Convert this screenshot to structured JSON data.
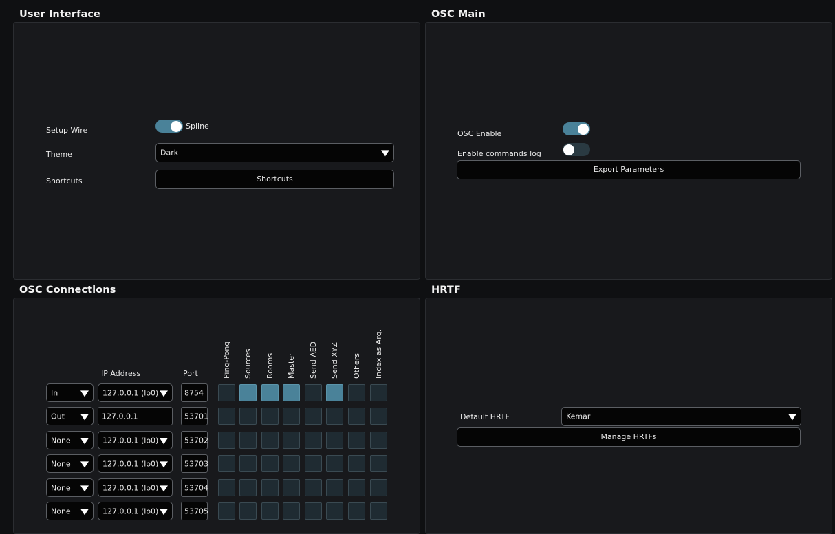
{
  "ui": {
    "title": "User Interface",
    "setup_wire_label": "Setup Wire",
    "setup_wire_toggle_label": "Spline",
    "setup_wire_on": true,
    "theme_label": "Theme",
    "theme_value": "Dark",
    "shortcuts_label": "Shortcuts",
    "shortcuts_button": "Shortcuts"
  },
  "osc_main": {
    "title": "OSC Main",
    "enable_label": "OSC Enable",
    "enable_on": true,
    "log_label": "Enable commands log",
    "log_on": false,
    "export_button": "Export Parameters"
  },
  "osc_conn": {
    "title": "OSC Connections",
    "ip_header": "IP Address",
    "port_header": "Port",
    "columns": [
      "Ping-Pong",
      "Sources",
      "Rooms",
      "Master",
      "Send AED",
      "Send XYZ",
      "Others",
      "Index as Arg."
    ],
    "rows": [
      {
        "direction": "In",
        "ip": "127.0.0.1 (lo0)",
        "ip_is_combo": true,
        "port": "8754",
        "checks": [
          false,
          true,
          true,
          true,
          false,
          true,
          false,
          false
        ]
      },
      {
        "direction": "Out",
        "ip": "127.0.0.1",
        "ip_is_combo": false,
        "port": "53701",
        "checks": [
          false,
          false,
          false,
          false,
          false,
          false,
          false,
          false
        ]
      },
      {
        "direction": "None",
        "ip": "127.0.0.1 (lo0)",
        "ip_is_combo": true,
        "port": "53702",
        "checks": [
          false,
          false,
          false,
          false,
          false,
          false,
          false,
          false
        ]
      },
      {
        "direction": "None",
        "ip": "127.0.0.1 (lo0)",
        "ip_is_combo": true,
        "port": "53703",
        "checks": [
          false,
          false,
          false,
          false,
          false,
          false,
          false,
          false
        ]
      },
      {
        "direction": "None",
        "ip": "127.0.0.1 (lo0)",
        "ip_is_combo": true,
        "port": "53704",
        "checks": [
          false,
          false,
          false,
          false,
          false,
          false,
          false,
          false
        ]
      },
      {
        "direction": "None",
        "ip": "127.0.0.1 (lo0)",
        "ip_is_combo": true,
        "port": "53705",
        "checks": [
          false,
          false,
          false,
          false,
          false,
          false,
          false,
          false
        ]
      }
    ]
  },
  "hrtf": {
    "title": "HRTF",
    "default_label": "Default HRTF",
    "default_value": "Kemar",
    "manage_button": "Manage HRTFs"
  },
  "colors": {
    "accent": "#4a8299",
    "panel_bg": "#18191c",
    "window_bg": "#0f1012"
  }
}
